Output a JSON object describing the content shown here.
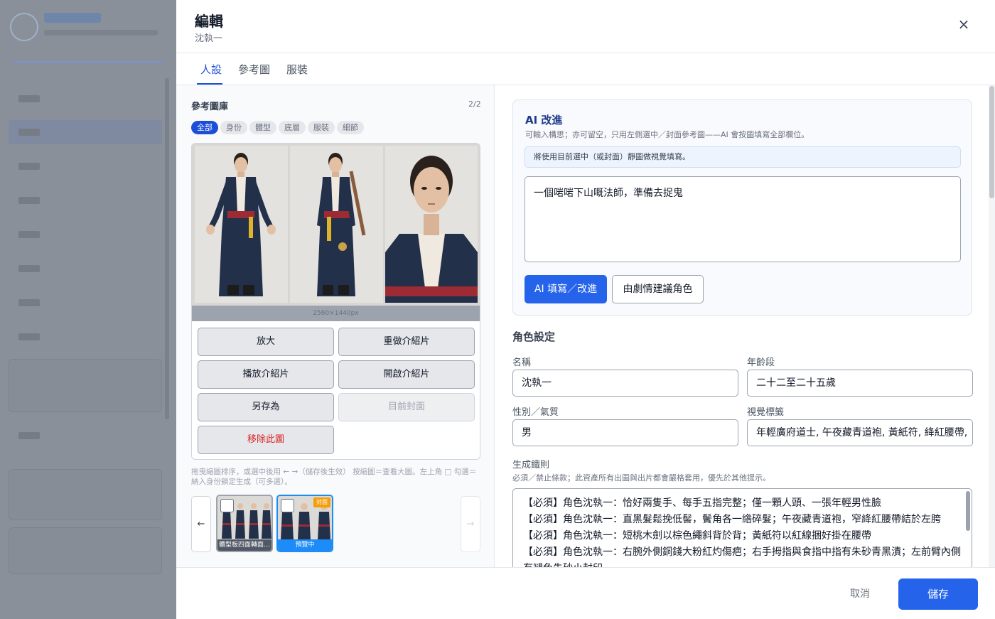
{
  "drawer": {
    "title": "編輯",
    "subtitle": "沈執一",
    "close_icon": "close-icon ×"
  },
  "tabs": [
    {
      "label": "人設",
      "active": true
    },
    {
      "label": "參考圖",
      "active": false
    },
    {
      "label": "服裝",
      "active": false
    }
  ],
  "gallery": {
    "title": "參考圖庫",
    "count": "2/2",
    "chips": [
      {
        "label": "全部",
        "active": true
      },
      {
        "label": "身份",
        "active": false
      },
      {
        "label": "體型",
        "active": false
      },
      {
        "label": "底層",
        "active": false
      },
      {
        "label": "服裝",
        "active": false
      },
      {
        "label": "細節",
        "active": false
      }
    ],
    "dimensions": "2560×1440px",
    "actions": {
      "enlarge": "放大",
      "redo_intro": "重做介紹片",
      "play_intro": "播放介紹片",
      "open_intro": "開啟介紹片",
      "save_as": "另存為",
      "current_cover": "目前封面",
      "remove": "移除此圖"
    },
    "help": "拖曳縮圖排序，或選中後用 ← →（儲存後生效） 按縮圖＝查看大圖。左上角 □ 勾選＝納入身份鎖定生成（可多選）。",
    "prev_arrow": "←",
    "next_arrow": "→",
    "thumbnails": [
      {
        "caption": "體型板四面轉面…",
        "selected": false,
        "cover": false
      },
      {
        "caption": "預覽中",
        "selected": true,
        "cover": true,
        "badge": "封面"
      }
    ]
  },
  "ai": {
    "title": "AI 改進",
    "description": "可輸入構思；亦可留空，只用左側選中／封面參考圖——AI 會按圖填寫全部欄位。",
    "note": "將使用目前選中（或封面）靜圖做視覺填寫。",
    "prompt_value": "一個啱啱下山嘅法師，準備去捉鬼",
    "fill_button": "AI 填寫／改進",
    "suggest_button": "由劇情建議角色"
  },
  "character": {
    "section_title": "角色設定",
    "name_label": "名稱",
    "name_value": "沈執一",
    "age_label": "年齡段",
    "age_value": "二十二至二十五歲",
    "gender_label": "性別／氣質",
    "gender_value": "男",
    "tags_label": "視覺標籤",
    "tags_value": "年輕廣府道士, 午夜藏青道袍, 黃紙符, 絳紅腰帶,",
    "rules_label": "生成鐵則",
    "rules_desc": "必須／禁止條款；此資產所有出圖與出片都會嚴格套用，優先於其他提示。",
    "rules": [
      "【必須】角色沈執一：恰好兩隻手、每手五指完整；僅一顆人頭、一張年輕男性臉",
      "【必須】角色沈執一：直黑髮鬆挽低髻，鬢角各一綹碎髮；午夜藏青道袍，窄絳紅腰帶結於左胯",
      "【必須】角色沈執一：短桃木劍以棕色繩斜背於背；黃紙符以紅線捆好掛在腰帶",
      "【必須】角色沈執一：右腕外側銅錢大粉紅灼傷疤；右手拇指與食指中指有朱砂青黑漬；左前臂內側有褪色朱砂小封印"
    ]
  },
  "footer": {
    "cancel": "取消",
    "save": "儲存"
  },
  "colors": {
    "primary": "#2563eb",
    "danger": "#dc2626",
    "cover_badge": "#f59e0b",
    "selected_border": "#1d8cf8"
  }
}
